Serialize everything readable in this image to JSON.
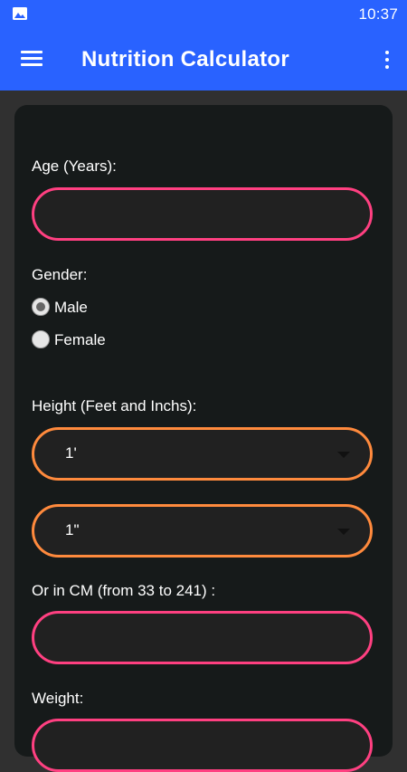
{
  "status_bar": {
    "time": "10:37",
    "notification_icon": "image-icon"
  },
  "app_bar": {
    "title": "Nutrition Calculator",
    "menu_icon": "hamburger-menu-icon",
    "overflow_icon": "more-vert-icon",
    "color": "#2962ff"
  },
  "form": {
    "age_label": "Age (Years):",
    "age_value": "",
    "gender_label": "Gender:",
    "gender_options": [
      {
        "label": "Male",
        "selected": true
      },
      {
        "label": "Female",
        "selected": false
      }
    ],
    "height_label": "Height (Feet and Inchs):",
    "height_feet_value": "1'",
    "height_inches_value": "1\"",
    "cm_label": "Or in CM (from 33 to 241) :",
    "cm_value": "",
    "weight_label": "Weight:"
  },
  "colors": {
    "input_border": "#ff4081",
    "select_border": "#ff8a3d",
    "card_background": "#161a1a",
    "page_background": "#303030"
  }
}
